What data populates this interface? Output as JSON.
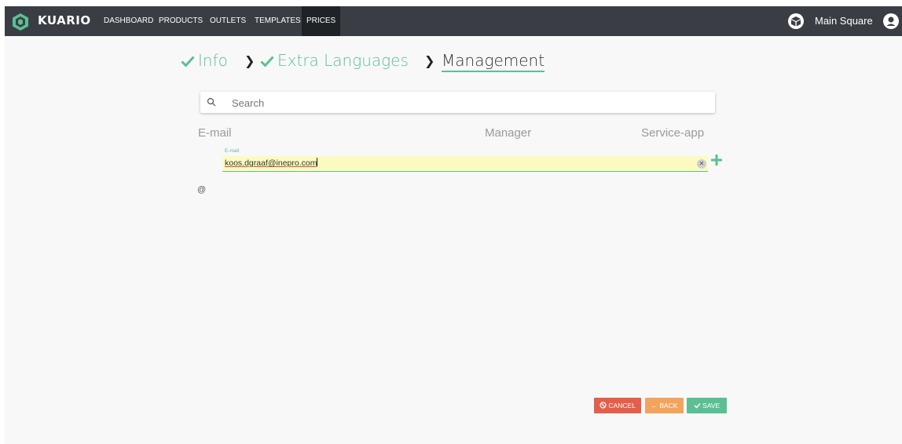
{
  "app": {
    "brand": "KUARIO"
  },
  "nav": {
    "items": [
      {
        "label": "DASHBOARD"
      },
      {
        "label": "PRODUCTS"
      },
      {
        "label": "OUTLETS"
      },
      {
        "label": "TEMPLATES"
      },
      {
        "label": "PRICES"
      }
    ],
    "active": "PRICES"
  },
  "header": {
    "store_name": "Main Square"
  },
  "stepper": {
    "steps": [
      {
        "label": "Info",
        "state": "done"
      },
      {
        "label": "Extra Languages",
        "state": "done"
      },
      {
        "label": "Management",
        "state": "current"
      }
    ]
  },
  "search": {
    "placeholder": "Search",
    "value": ""
  },
  "table": {
    "columns": [
      "E-mail",
      "Manager",
      "Service-app"
    ]
  },
  "email_row": {
    "prefix": "@",
    "label": "E-mail",
    "value": "koos.dgraaf@inepro.com"
  },
  "actions": {
    "cancel": "CANCEL",
    "back": "BACK",
    "save": "SAVE"
  },
  "colors": {
    "topbar": "#3a3e44",
    "accent_green": "#5cbf93",
    "cancel_red": "#e2604b",
    "back_orange": "#f2a45e",
    "field_highlight": "#fbfbbf"
  },
  "icons": [
    "logo-icon",
    "store-box-icon",
    "user-icon",
    "search-icon",
    "check-icon",
    "chevron-right-icon",
    "clear-icon",
    "plus-icon",
    "ban-icon",
    "arrow-left-icon"
  ]
}
